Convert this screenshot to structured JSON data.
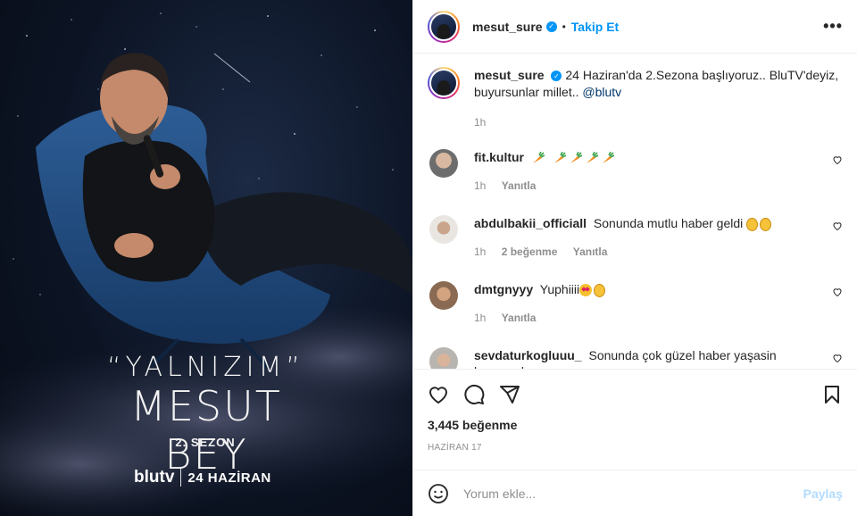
{
  "poster": {
    "line1": "“YALNIZIM”",
    "line2": "MESUT BEY",
    "season": "2. SEZON",
    "brand": "blutv",
    "date": "24 HAZİRAN"
  },
  "header": {
    "username": "mesut_sure",
    "dot": "•",
    "follow_label": "Takip Et",
    "more_label": "•••"
  },
  "caption": {
    "username": "mesut_sure",
    "text": "24 Haziran'da 2.Sezona başlıyoruz.. BluTV'deyiz, buyursunlar millet..",
    "mention": "@blutv",
    "time": "1h"
  },
  "comments": [
    {
      "username": "fit.kultur",
      "text": "",
      "emoji": "carrot",
      "emoji_count": 5,
      "time": "1h",
      "likes": "",
      "reply": "Yanıtla"
    },
    {
      "username": "abdulbakii_officiall",
      "text": "Sonunda mutlu haber geldi",
      "emoji": "clap",
      "emoji_count": 2,
      "time": "1h",
      "likes": "2 beğenme",
      "reply": "Yanıtla"
    },
    {
      "username": "dmtgnyyy",
      "text": "Yuphiiii",
      "emoji": "mixed",
      "emoji_count": 2,
      "time": "1h",
      "likes": "",
      "reply": "Yanıtla"
    },
    {
      "username": "sevdaturkogluuu_",
      "text": "Sonunda çok güzel haber yaşasin heyecanla",
      "emoji": "",
      "emoji_count": 0,
      "time": "",
      "likes": "",
      "reply": ""
    }
  ],
  "actions": {
    "likes": "3,445 beğenme",
    "date": "HAZİRAN 17"
  },
  "add_comment": {
    "placeholder": "Yorum ekle...",
    "post_label": "Paylaş"
  },
  "colors": {
    "accent": "#0095f6",
    "muted": "#8e8e8e",
    "post_disabled": "#b3dbff"
  }
}
